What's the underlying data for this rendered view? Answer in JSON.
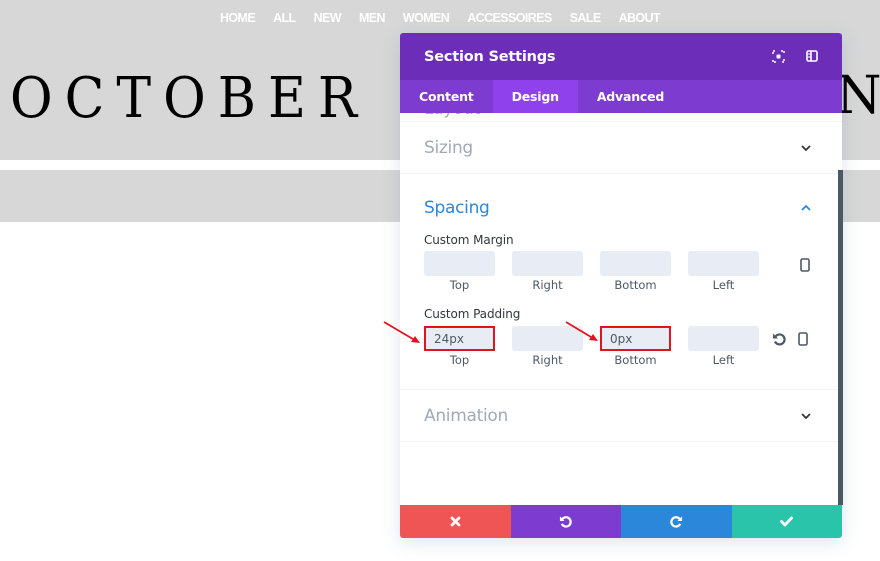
{
  "site": {
    "nav": [
      "HOME",
      "ALL",
      "NEW",
      "MEN",
      "WOMEN",
      "ACCESSOIRES",
      "SALE",
      "ABOUT"
    ],
    "brand_text": "OCTOBER",
    "brand_tail": "N"
  },
  "panel": {
    "title": "Section Settings",
    "header_icons": [
      "fullscreen-icon",
      "sidebar-layout-icon"
    ],
    "tabs": [
      {
        "label": "Content",
        "active": false
      },
      {
        "label": "Design",
        "active": true
      },
      {
        "label": "Advanced",
        "active": false
      }
    ],
    "toggles": {
      "layout": {
        "title": "Layout",
        "open": false
      },
      "sizing": {
        "title": "Sizing",
        "open": false
      },
      "spacing": {
        "title": "Spacing",
        "open": true
      },
      "animation": {
        "title": "Animation",
        "open": false
      }
    },
    "spacing": {
      "custom_margin": {
        "label": "Custom Margin",
        "fields": [
          {
            "caption": "Top",
            "value": ""
          },
          {
            "caption": "Right",
            "value": ""
          },
          {
            "caption": "Bottom",
            "value": ""
          },
          {
            "caption": "Left",
            "value": ""
          }
        ]
      },
      "custom_padding": {
        "label": "Custom Padding",
        "fields": [
          {
            "caption": "Top",
            "value": "24px",
            "highlighted": true
          },
          {
            "caption": "Right",
            "value": "",
            "highlighted": false
          },
          {
            "caption": "Bottom",
            "value": "0px",
            "highlighted": true
          },
          {
            "caption": "Left",
            "value": "",
            "highlighted": false
          }
        ]
      }
    },
    "footer_buttons": [
      {
        "name": "discard",
        "icon": "close-icon",
        "color": "#ef5555"
      },
      {
        "name": "undo",
        "icon": "undo-icon",
        "color": "#7e3bd0"
      },
      {
        "name": "redo",
        "icon": "redo-icon",
        "color": "#2b87da"
      },
      {
        "name": "save",
        "icon": "check-icon",
        "color": "#29c4a9"
      }
    ]
  },
  "colors": {
    "header": "#6c2eb9",
    "tabs": "#7e3bd0",
    "active_tab": "#8f42ec",
    "open_toggle": "#2b87da",
    "highlight": "#e1141e"
  }
}
